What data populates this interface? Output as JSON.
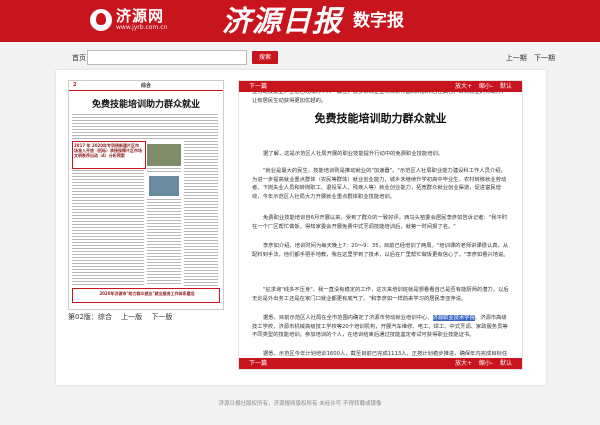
{
  "brand": {
    "logo_name": "济源网",
    "logo_url": "www.jyrb.com.cn",
    "masthead": "济源日报",
    "subhead": "数字报"
  },
  "search": {
    "label": "首页",
    "placeholder": "",
    "button": "搜索"
  },
  "top_nav": {
    "prev_page": "上一期",
    "next_page": "下一期"
  },
  "page": {
    "number": "2",
    "section": "综合",
    "headline": "免费技能培训助力群众就业",
    "box1": "2017 年 2020年专项债新建片区市场准入开放（招标）承接保障片区市场文明秩序出动（4）分析预案",
    "box2": "2020年济源市\"助力群众就业\"就业服务工作体系建设"
  },
  "page_nav": {
    "label": "第02版：综合",
    "prev": "上一版",
    "next": "下一版"
  },
  "article_bar": {
    "left": "下一篇",
    "zoom_in": "放大+",
    "zoom_out": "缩小-",
    "default": "默认"
  },
  "article": {
    "title": "免费技能培训助力群众就业",
    "p0": "业劳动技能业，生活已经成为个人一最佳，很多来询企业项目获得面向的群众居住其它，转到就业的劳动力，让有居民生动获得更加优越的。",
    "p1": "据了解，这是示范区人社局开展的职业技能提升行动中的免费职业技能培训。",
    "p2": "\"就业是最大的民生，技能培训则是推动就业的\"加速器\"。\"示范区人社局职业能力建设科工作人员介绍，为进一步提高就业重点群体（农民等群体）就业创业能力，城乡未继续升学初高中毕业生、农村转移就业劳动者、下岗失业人员和转岗职工、退役军人、残疾人等）就业创业能力，拓宽群众就业创业渠道，促进富民增收，今年示范区人社局大力开展就业重点群体职业技能培训。",
    "p3": "免费职业技能培训自6月开展以来，受到了群众的一致好评。西乌头窑委会居民李彦如告诉记者：\"我平时在一个厂区帮忙做饭，得知家委会开展免费中式烹调技能培训后，就第一时间报了名。\"",
    "p4": "李彦如介绍，培训时间为每天晚上7：20～9：35，目前已经培训了两周。\"培训课的老师讲课很认真，从配料到手法，他们都手把手地教，我在这里学到了技术，以后在厂里帮忙做饭更有信心了。\"李彦如看兴地说。",
    "p5": "\"征求询\"线多不压身\"，我一直没有稳定的工作，这次来培训班就是想看看自己是否有能厨师的潜力，以后无论是外出务工还是在家门口就业都更有底气了。\"和李彦如一样前来学习的居民李亚萍说。",
    "p6_pre": "据悉，目前示范区人社局在全市范围内确定了济源市劳动就业培训中心、",
    "p6_hl": "济源职业技术学院",
    "p6_post": "、济源市高级技工学校、济源市机械高级技工学校等20个培训机构，开展汽车维修、电工、焊工、中式烹调、家政服务员等不同类型的技能培训。参加培训的个人，在培训结束后通过技能鉴定考试可获得职业技能证书。",
    "p7": "据悉，示范区今年计划培训1600人，截至目前已完成1113人，正按计划稳步推进，确保年内完成目标任务。"
  },
  "footer": {
    "text": "济源日报社版权所有，济源报网版权所有 未经许可 不得转载或镜像"
  },
  "colors": {
    "brand_red": "#c8141d",
    "highlight_blue": "#3a66c7"
  }
}
